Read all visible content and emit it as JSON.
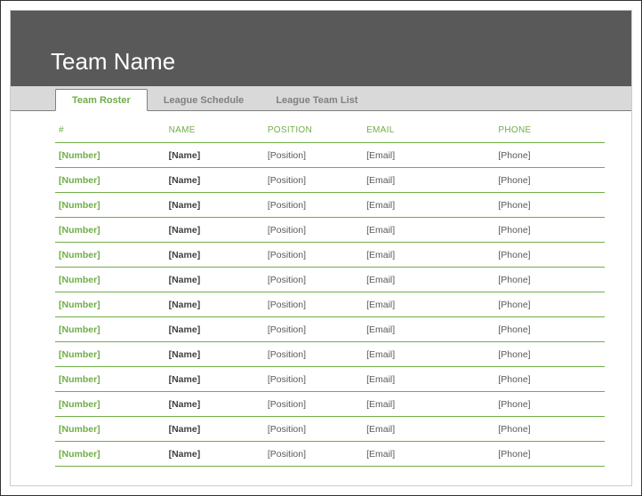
{
  "header": {
    "title": "Team Name"
  },
  "tabs": [
    {
      "label": "Team Roster",
      "active": true
    },
    {
      "label": "League Schedule",
      "active": false
    },
    {
      "label": "League Team List",
      "active": false
    }
  ],
  "columns": [
    "#",
    "NAME",
    "POSITION",
    "EMAIL",
    "PHONE"
  ],
  "rows": [
    {
      "number": "[Number]",
      "name": "[Name]",
      "position": "[Position]",
      "email": "[Email]",
      "phone": "[Phone]"
    },
    {
      "number": "[Number]",
      "name": "[Name]",
      "position": "[Position]",
      "email": "[Email]",
      "phone": "[Phone]"
    },
    {
      "number": "[Number]",
      "name": "[Name]",
      "position": "[Position]",
      "email": "[Email]",
      "phone": "[Phone]"
    },
    {
      "number": "[Number]",
      "name": "[Name]",
      "position": "[Position]",
      "email": "[Email]",
      "phone": "[Phone]"
    },
    {
      "number": "[Number]",
      "name": "[Name]",
      "position": "[Position]",
      "email": "[Email]",
      "phone": "[Phone]"
    },
    {
      "number": "[Number]",
      "name": "[Name]",
      "position": "[Position]",
      "email": "[Email]",
      "phone": "[Phone]"
    },
    {
      "number": "[Number]",
      "name": "[Name]",
      "position": "[Position]",
      "email": "[Email]",
      "phone": "[Phone]"
    },
    {
      "number": "[Number]",
      "name": "[Name]",
      "position": "[Position]",
      "email": "[Email]",
      "phone": "[Phone]"
    },
    {
      "number": "[Number]",
      "name": "[Name]",
      "position": "[Position]",
      "email": "[Email]",
      "phone": "[Phone]"
    },
    {
      "number": "[Number]",
      "name": "[Name]",
      "position": "[Position]",
      "email": "[Email]",
      "phone": "[Phone]"
    },
    {
      "number": "[Number]",
      "name": "[Name]",
      "position": "[Position]",
      "email": "[Email]",
      "phone": "[Phone]"
    },
    {
      "number": "[Number]",
      "name": "[Name]",
      "position": "[Position]",
      "email": "[Email]",
      "phone": "[Phone]"
    },
    {
      "number": "[Number]",
      "name": "[Name]",
      "position": "[Position]",
      "email": "[Email]",
      "phone": "[Phone]"
    }
  ]
}
